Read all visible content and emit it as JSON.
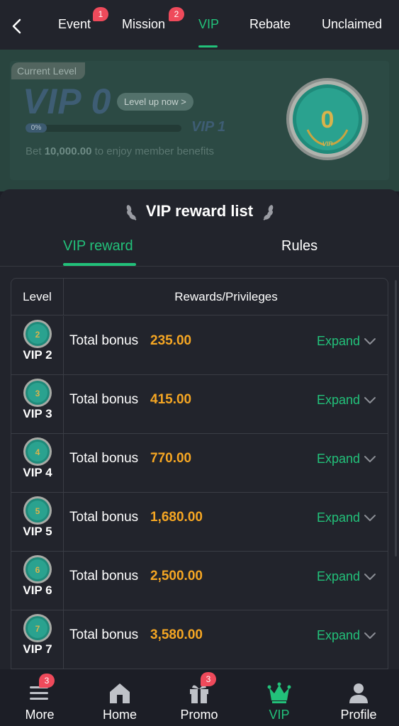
{
  "colors": {
    "accent": "#22c17a",
    "amount": "#f5a623",
    "badge": "#ef4a5b",
    "background": "#1c1e26"
  },
  "topnav": {
    "tabs": [
      {
        "label": "Event",
        "badge": "1"
      },
      {
        "label": "Mission",
        "badge": "2"
      },
      {
        "label": "VIP",
        "active": true
      },
      {
        "label": "Rebate"
      },
      {
        "label": "Unclaimed"
      }
    ]
  },
  "vip_card": {
    "current_level_label": "Current Level",
    "current_vip": "VIP 0",
    "level_up_label": "Level up now >",
    "progress_text": "0%",
    "progress": 0,
    "next_vip": "VIP 1",
    "bet_prefix": "Bet ",
    "bet_amount": "10,000.00",
    "bet_suffix": " to enjoy member benefits",
    "medal_number": "0",
    "medal_text": "VIP"
  },
  "reward_panel": {
    "title": "VIP reward list",
    "tabs": [
      {
        "label": "VIP reward",
        "active": true
      },
      {
        "label": "Rules"
      }
    ],
    "header": {
      "level": "Level",
      "rewards": "Rewards/Privileges"
    },
    "rows": [
      {
        "coin": "2",
        "level": "VIP 2",
        "label": "Total bonus",
        "amount": "235.00",
        "expand": "Expand"
      },
      {
        "coin": "3",
        "level": "VIP 3",
        "label": "Total bonus",
        "amount": "415.00",
        "expand": "Expand"
      },
      {
        "coin": "4",
        "level": "VIP 4",
        "label": "Total bonus",
        "amount": "770.00",
        "expand": "Expand"
      },
      {
        "coin": "5",
        "level": "VIP 5",
        "label": "Total bonus",
        "amount": "1,680.00",
        "expand": "Expand"
      },
      {
        "coin": "6",
        "level": "VIP 6",
        "label": "Total bonus",
        "amount": "2,500.00",
        "expand": "Expand"
      },
      {
        "coin": "7",
        "level": "VIP 7",
        "label": "Total bonus",
        "amount": "3,580.00",
        "expand": "Expand"
      }
    ]
  },
  "bottomnav": {
    "items": [
      {
        "label": "More",
        "icon": "menu-icon",
        "badge": "3"
      },
      {
        "label": "Home",
        "icon": "home-icon"
      },
      {
        "label": "Promo",
        "icon": "gift-icon",
        "badge": "3"
      },
      {
        "label": "VIP",
        "icon": "crown-icon",
        "active": true
      },
      {
        "label": "Profile",
        "icon": "profile-icon"
      }
    ]
  }
}
